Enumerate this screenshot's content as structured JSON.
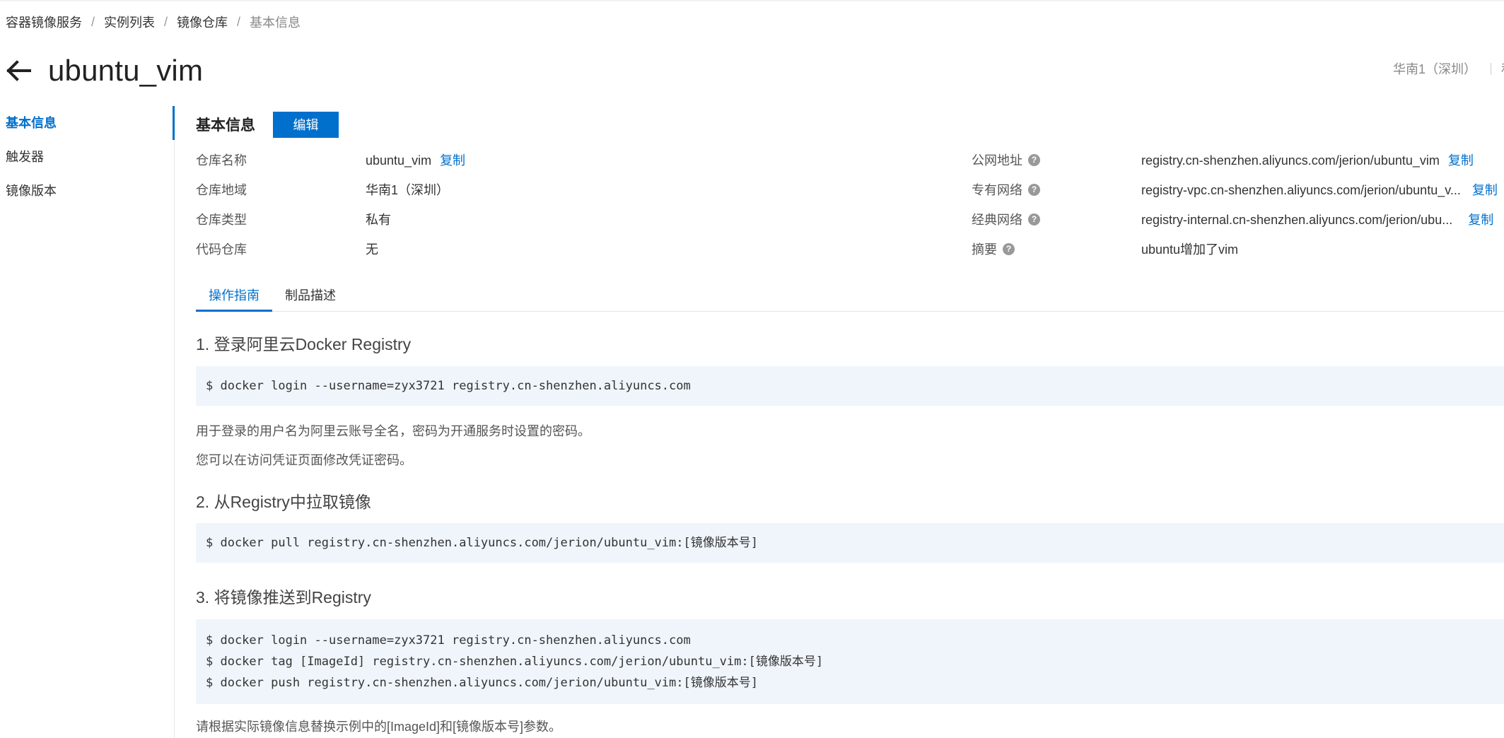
{
  "breadcrumb": {
    "items": [
      "容器镜像服务",
      "实例列表",
      "镜像仓库"
    ],
    "current": "基本信息",
    "separator": "/"
  },
  "header": {
    "title": "ubuntu_vim",
    "region": "华南1（深圳）",
    "visibility_truncated": "私"
  },
  "sidebar": {
    "items": [
      {
        "label": "基本信息",
        "active": true
      },
      {
        "label": "触发器",
        "active": false
      },
      {
        "label": "镜像版本",
        "active": false
      }
    ]
  },
  "basic_info": {
    "section_title": "基本信息",
    "edit_label": "编辑",
    "copy_label": "复制",
    "left": [
      {
        "label": "仓库名称",
        "value": "ubuntu_vim"
      },
      {
        "label": "仓库地域",
        "value": "华南1（深圳）"
      },
      {
        "label": "仓库类型",
        "value": "私有"
      },
      {
        "label": "代码仓库",
        "value": "无"
      }
    ],
    "right": [
      {
        "label": "公网地址",
        "value": "registry.cn-shenzhen.aliyuncs.com/jerion/ubuntu_vim"
      },
      {
        "label": "专有网络",
        "value": "registry-vpc.cn-shenzhen.aliyuncs.com/jerion/ubuntu_v..."
      },
      {
        "label": "经典网络",
        "value": "registry-internal.cn-shenzhen.aliyuncs.com/jerion/ubu..."
      },
      {
        "label": "摘要",
        "value": "ubuntu增加了vim"
      }
    ]
  },
  "tabs": [
    {
      "label": "操作指南",
      "active": true
    },
    {
      "label": "制品描述",
      "active": false
    }
  ],
  "guide": {
    "step1": {
      "title": "1. 登录阿里云Docker Registry",
      "code": [
        "$ docker login --username=zyx3721 registry.cn-shenzhen.aliyuncs.com"
      ],
      "notes": [
        "用于登录的用户名为阿里云账号全名，密码为开通服务时设置的密码。",
        "您可以在访问凭证页面修改凭证密码。"
      ]
    },
    "step2": {
      "title": "2. 从Registry中拉取镜像",
      "code": [
        "$ docker pull registry.cn-shenzhen.aliyuncs.com/jerion/ubuntu_vim:[镜像版本号]"
      ]
    },
    "step3": {
      "title": "3. 将镜像推送到Registry",
      "code": [
        "$ docker login --username=zyx3721 registry.cn-shenzhen.aliyuncs.com",
        "$ docker tag [ImageId] registry.cn-shenzhen.aliyuncs.com/jerion/ubuntu_vim:[镜像版本号]",
        "$ docker push registry.cn-shenzhen.aliyuncs.com/jerion/ubuntu_vim:[镜像版本号]"
      ],
      "note": "请根据实际镜像信息替换示例中的[ImageId]和[镜像版本号]参数。"
    }
  },
  "colors": {
    "accent": "#0070cc",
    "code_bg": "#eff5fb"
  }
}
